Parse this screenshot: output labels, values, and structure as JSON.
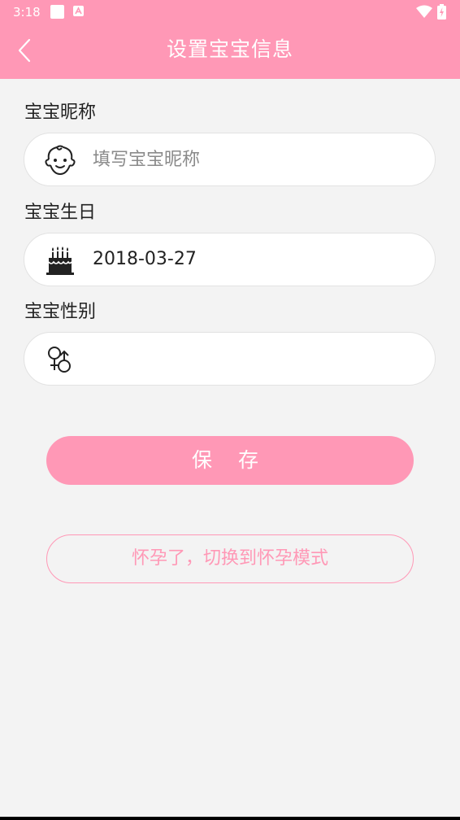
{
  "status_bar": {
    "time": "3:18",
    "notification_icons": [
      "app-notification-icon",
      "a-notification-icon"
    ],
    "wifi_icon": "wifi-icon",
    "battery_icon": "battery-charging-icon"
  },
  "app_bar": {
    "title": "设置宝宝信息",
    "back_icon": "chevron-left-icon"
  },
  "form": {
    "nickname": {
      "label": "宝宝昵称",
      "placeholder": "填写宝宝昵称",
      "value": "",
      "icon": "baby-face-icon"
    },
    "birthday": {
      "label": "宝宝生日",
      "value": "2018-03-27",
      "icon": "birthday-cake-icon"
    },
    "gender": {
      "label": "宝宝性别",
      "value": "",
      "icon": "gender-symbols-icon"
    }
  },
  "actions": {
    "save_label": "保 存",
    "switch_mode_label": "怀孕了，切换到怀孕模式"
  },
  "colors": {
    "brand_pink": "#ff98b6",
    "background": "#f3f3f3",
    "field_background": "#ffffff"
  }
}
